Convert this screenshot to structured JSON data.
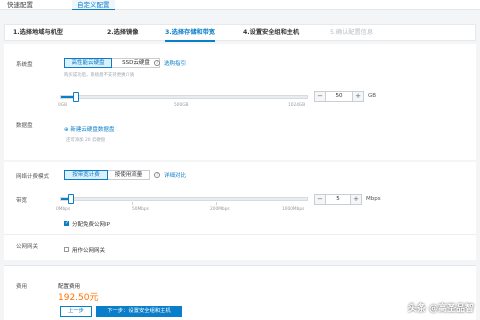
{
  "top_tabs": [
    {
      "label": "快速配置",
      "active": false
    },
    {
      "label": "自定义配置",
      "active": true
    }
  ],
  "steps": [
    {
      "label": "1.选择地域与机型",
      "state": "done"
    },
    {
      "label": "2.选择镜像",
      "state": "done"
    },
    {
      "label": "3.选择存储和带宽",
      "state": "active"
    },
    {
      "label": "4.设置安全组和主机",
      "state": "todo"
    },
    {
      "label": "5.确认配置信息",
      "state": "disabled"
    }
  ],
  "system_disk": {
    "label": "系统盘",
    "types": [
      "高性能云硬盘",
      "SSD云硬盘"
    ],
    "selected": "高性能云硬盘",
    "help_link": "选购指引",
    "note": "购买成功后，系统盘不支持更换介质",
    "slider": {
      "min_label": "0GB",
      "mid_label": "500GB",
      "max_label": "1024GB",
      "value_gb": 50,
      "max_gb": 1024
    },
    "value": "50",
    "unit": "GB"
  },
  "data_disk": {
    "label": "数据盘",
    "add_link": "新建云硬盘数据盘",
    "remaining": "还可添加 20 云硬盘"
  },
  "network": {
    "label": "网络计费模式",
    "types": [
      "按带宽计费",
      "按使用流量"
    ],
    "selected": "按带宽计费",
    "help_link": "详细对比",
    "bandwidth_label": "带宽",
    "slider": {
      "ticks": [
        "0Mbps",
        "50Mbps",
        "200Mbps",
        "1000Mbps"
      ],
      "value_mbps": 5
    },
    "value": "5",
    "unit": "Mbps",
    "assign_ip": {
      "label": "分配免费公网IP",
      "checked": true
    }
  },
  "public_gateway": {
    "label": "公网网关",
    "option": {
      "label": "用作公网网关",
      "checked": false
    }
  },
  "fee": {
    "label": "费用",
    "config_fee_label": "配置费用",
    "price": "192.50元"
  },
  "buttons": {
    "prev": "上一步",
    "next": "下一步：设置安全组和主机"
  },
  "watermark": "头条 @高圣品智"
}
